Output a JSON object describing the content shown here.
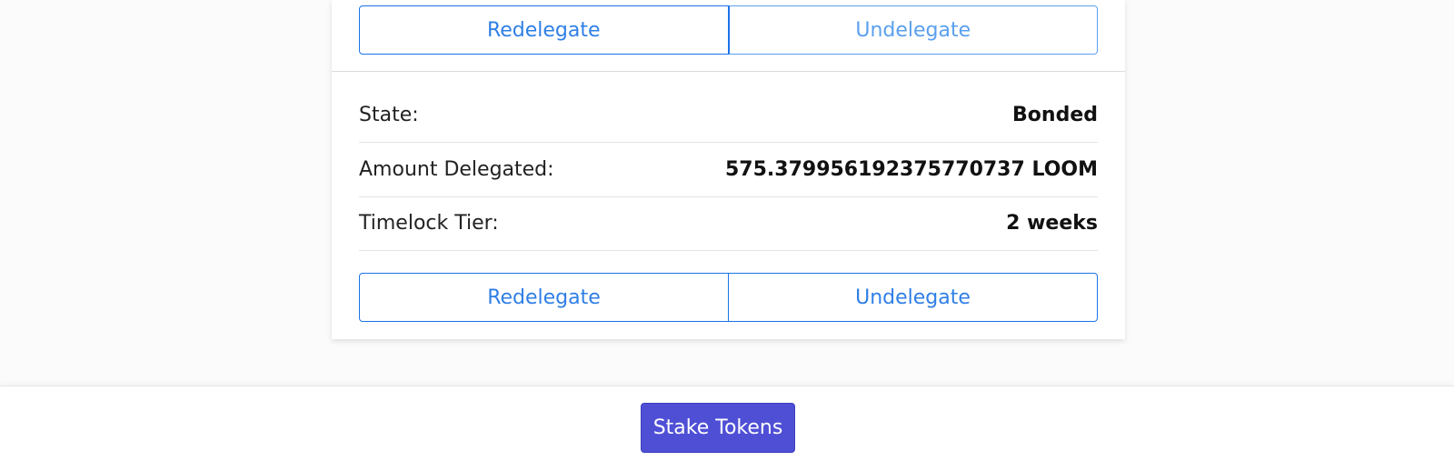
{
  "top_actions": {
    "redelegate_label": "Redelegate",
    "undelegate_label": "Undelegate"
  },
  "delegation": {
    "rows": [
      {
        "label": "State:",
        "value": "Bonded"
      },
      {
        "label": "Amount Delegated:",
        "value": "575.379956192375770737 LOOM"
      },
      {
        "label": "Timelock Tier:",
        "value": "2 weeks"
      }
    ]
  },
  "bottom_actions": {
    "redelegate_label": "Redelegate",
    "undelegate_label": "Undelegate"
  },
  "footer": {
    "stake_label": "Stake Tokens"
  },
  "colors": {
    "accent_blue": "#1a73e8",
    "stake_button": "#4f4fd6"
  }
}
